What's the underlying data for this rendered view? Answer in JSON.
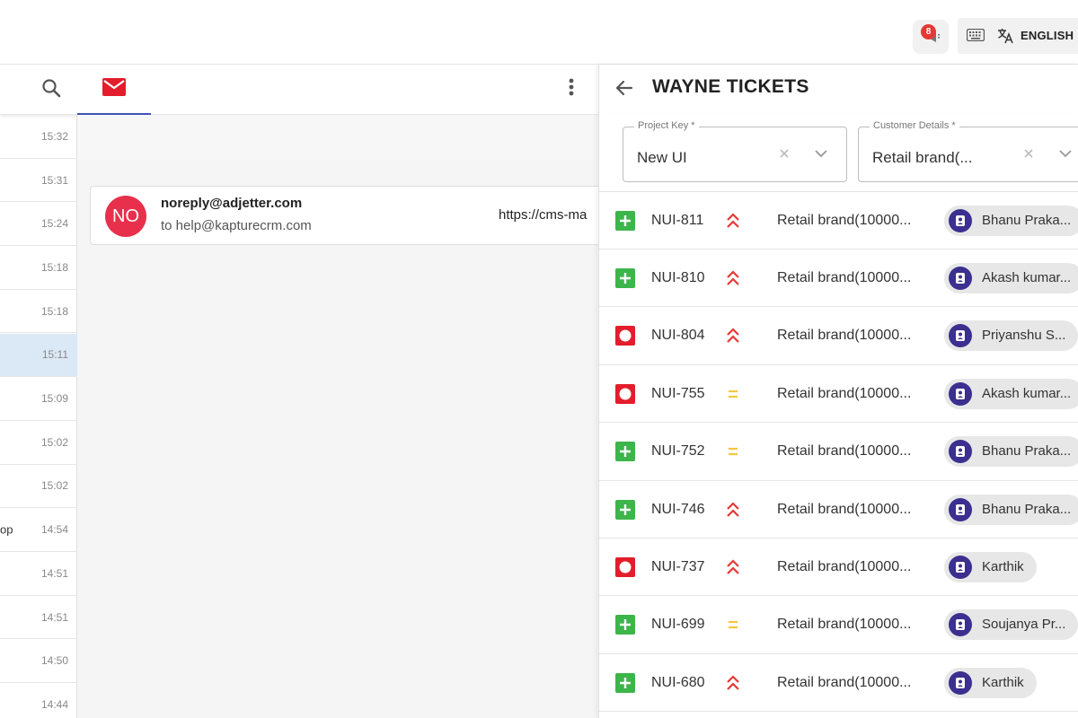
{
  "topbar": {
    "notification_count": "8",
    "language_label": "ENGLISH"
  },
  "left_list": {
    "rows": [
      {
        "time": "15:32",
        "snippet": ""
      },
      {
        "time": "15:31",
        "snippet": ""
      },
      {
        "time": "15:24",
        "snippet": ""
      },
      {
        "time": "15:18",
        "snippet": ""
      },
      {
        "time": "15:18",
        "snippet": ""
      },
      {
        "time": "15:11",
        "snippet": "",
        "selected": true
      },
      {
        "time": "15:09",
        "snippet": ""
      },
      {
        "time": "15:02",
        "snippet": ""
      },
      {
        "time": "15:02",
        "snippet": ""
      },
      {
        "time": "14:54",
        "snippet": "op"
      },
      {
        "time": "14:51",
        "snippet": ""
      },
      {
        "time": "14:51",
        "snippet": ""
      },
      {
        "time": "14:50",
        "snippet": ""
      },
      {
        "time": "14:44",
        "snippet": ""
      }
    ]
  },
  "mail": {
    "avatar_initials": "NO",
    "from": "noreply@adjetter.com",
    "to": "to help@kapturecrm.com",
    "link_preview": "https://cms-ma"
  },
  "panel": {
    "title": "WAYNE TICKETS",
    "project_key": {
      "label": "Project Key *",
      "value": "New UI"
    },
    "customer_details": {
      "label": "Customer Details *",
      "value": "Retail brand(..."
    },
    "colors": {
      "status_new": "#3cb54a",
      "status_open": "#e31d2b",
      "priority_high": "#e53935",
      "priority_medium": "#f5c542",
      "assignee_avatar": "#3b2f8f"
    },
    "tickets": [
      {
        "status": "new",
        "id": "NUI-811",
        "priority": "high",
        "customer": "Retail brand(10000...",
        "assignee": "Bhanu Praka..."
      },
      {
        "status": "new",
        "id": "NUI-810",
        "priority": "high",
        "customer": "Retail brand(10000...",
        "assignee": "Akash kumar..."
      },
      {
        "status": "open",
        "id": "NUI-804",
        "priority": "high",
        "customer": "Retail brand(10000...",
        "assignee": "Priyanshu S..."
      },
      {
        "status": "open",
        "id": "NUI-755",
        "priority": "medium",
        "customer": "Retail brand(10000...",
        "assignee": "Akash kumar..."
      },
      {
        "status": "new",
        "id": "NUI-752",
        "priority": "medium",
        "customer": "Retail brand(10000...",
        "assignee": "Bhanu Praka..."
      },
      {
        "status": "new",
        "id": "NUI-746",
        "priority": "high",
        "customer": "Retail brand(10000...",
        "assignee": "Bhanu Praka..."
      },
      {
        "status": "open",
        "id": "NUI-737",
        "priority": "high",
        "customer": "Retail brand(10000...",
        "assignee": "Karthik"
      },
      {
        "status": "new",
        "id": "NUI-699",
        "priority": "medium",
        "customer": "Retail brand(10000...",
        "assignee": "Soujanya Pr..."
      },
      {
        "status": "new",
        "id": "NUI-680",
        "priority": "high",
        "customer": "Retail brand(10000...",
        "assignee": "Karthik"
      }
    ]
  }
}
